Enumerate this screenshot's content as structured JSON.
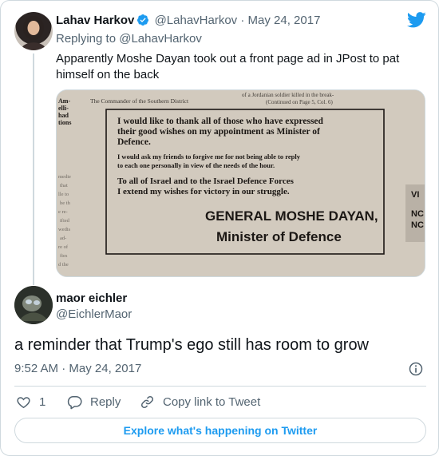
{
  "colors": {
    "accent": "#1d9bf0",
    "secondary_text": "#536471",
    "border": "#cfd9de"
  },
  "parent_tweet": {
    "author_name": "Lahav Harkov",
    "handle": "@LahavHarkov",
    "separator": "·",
    "date": "May 24, 2017",
    "replying_prefix": "Replying to",
    "replying_to": "@LahavHarkov",
    "text": "Apparently Moshe Dayan took out a front page ad in JPost to pat himself on the back",
    "media": {
      "top_left": "Am-\nelli-\nhad\ntions",
      "top_strip": "The Commander of the Southern District",
      "top_right": "of a Jordanian soldier killed in the break-\n(Continued on Page 5, Col. 6)",
      "line1": "I would like to thank all of those who have expressed",
      "line2": "their good wishes on my appointment as Minister of",
      "line3": "Defence.",
      "line4": "I would ask my friends to forgive me for not being able to reply",
      "line5": "to each one personally in view of the needs of the hour.",
      "line6": "To all of Israel and to the Israel Defence Forces",
      "line7": "I extend my wishes for victory in our struggle.",
      "signature1": "GENERAL MOSHE DAYAN,",
      "signature2": "Minister of Defence",
      "right_edge": "VI\nNC\nNC"
    }
  },
  "reply_tweet": {
    "author_name": "maor eichler",
    "handle": "@EichlerMaor",
    "text": "a reminder that Trump's ego still has room to grow",
    "time": "9:52 AM",
    "separator": "·",
    "date": "May 24, 2017"
  },
  "actions": {
    "like_count": "1",
    "reply_label": "Reply",
    "copy_label": "Copy link to Tweet"
  },
  "explore_label": "Explore what's happening on Twitter",
  "icons": [
    "twitter-bird-icon",
    "verified-badge-icon",
    "info-icon",
    "heart-icon",
    "reply-bubble-icon",
    "link-icon"
  ]
}
